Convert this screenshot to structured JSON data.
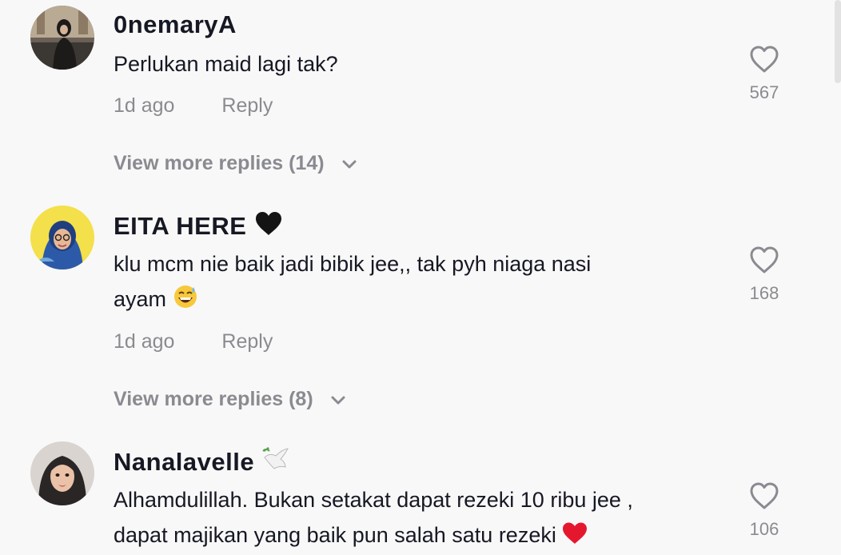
{
  "comments": [
    {
      "username": "0nemaryA",
      "text": "Perlukan maid lagi tak?",
      "time": "1d ago",
      "reply_label": "Reply",
      "likes": "567",
      "more_replies": "View more replies (14)"
    },
    {
      "username": "EITA HERE",
      "username_emoji": "black-heart-icon",
      "text_line1": "klu mcm nie baik jadi bibik jee,, tak pyh niaga nasi",
      "text_line2": "ayam",
      "text_emoji": "sweat-smile-emoji",
      "time": "1d ago",
      "reply_label": "Reply",
      "likes": "168",
      "more_replies": "View more replies (8)"
    },
    {
      "username": "Nanalavelle",
      "username_emoji": "dove-icon",
      "text_line1": "Alhamdulillah. Bukan setakat dapat rezeki 10 ribu jee ,",
      "text_line2": "dapat majikan yang baik pun salah satu rezeki",
      "text_emoji": "red-heart-emoji",
      "likes": "106"
    }
  ],
  "colors": {
    "background": "#f8f8f8",
    "primary_text": "#161823",
    "secondary_text": "#8a8b91"
  }
}
